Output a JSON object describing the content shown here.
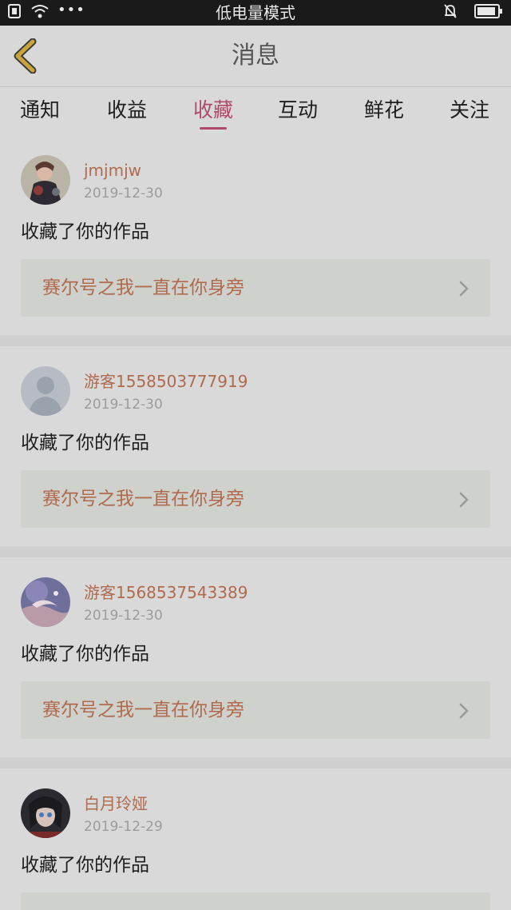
{
  "status_bar": {
    "title": "低电量模式",
    "dots": "•••",
    "icons": [
      "sim-icon",
      "wifi-icon",
      "bell-muted-icon",
      "battery-icon"
    ]
  },
  "header": {
    "title": "消息",
    "back_icon": "back-chevron-icon"
  },
  "tabs": [
    {
      "label": "通知",
      "active": false
    },
    {
      "label": "收益",
      "active": false
    },
    {
      "label": "收藏",
      "active": true
    },
    {
      "label": "互动",
      "active": false
    },
    {
      "label": "鲜花",
      "active": false
    },
    {
      "label": "关注",
      "active": false
    }
  ],
  "messages": [
    {
      "username": "jmjmjw",
      "date": "2019-12-30",
      "action": "收藏了你的作品",
      "work_title": "赛尔号之我一直在你身旁"
    },
    {
      "username": "游客1558503777919",
      "date": "2019-12-30",
      "action": "收藏了你的作品",
      "work_title": "赛尔号之我一直在你身旁"
    },
    {
      "username": "游客1568537543389",
      "date": "2019-12-30",
      "action": "收藏了你的作品",
      "work_title": "赛尔号之我一直在你身旁"
    },
    {
      "username": "白月玲娅",
      "date": "2019-12-29",
      "action": "收藏了你的作品",
      "work_title": ""
    }
  ],
  "colors": {
    "accent": "#b14a6a",
    "username": "#b06a4e",
    "back_icon": "#c9a43a",
    "background": "#d9d9d9"
  }
}
